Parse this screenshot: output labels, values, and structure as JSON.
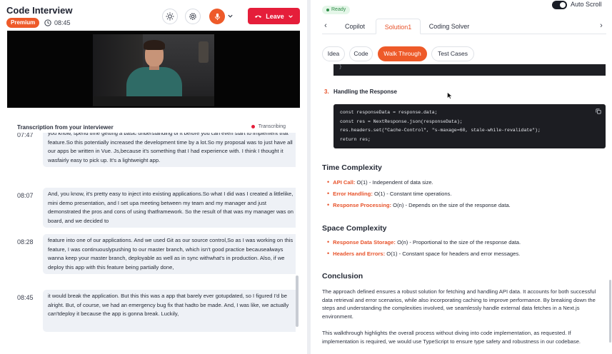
{
  "header": {
    "title": "Code Interview",
    "plan_badge": "Premium",
    "timer": "08:45",
    "leave_label": "Leave",
    "icons": [
      "sun-icon",
      "gear-icon",
      "microphone-icon",
      "chevron-down-icon"
    ]
  },
  "transcript": {
    "title": "Transcription from your interviewer",
    "status": "Transcribing",
    "items": [
      {
        "time": "07:47",
        "text": "you know, spend time getting a basic understanding of it before you can even start to implement that feature.So this potentially increased the development time by a lot.So my proposal was to just have all our apps be written in Vue. Js,because it's something that I had experience with. I think I thought it wasfairly easy to pick up. It's a lightweight app."
      },
      {
        "time": "08:07",
        "text": "And, you know, it's pretty easy to inject into existing applications.So what I did was I created a littlelike, mini demo presentation, and I set upa meeting between my team and my manager and just demonstrated the pros and cons of using thatframework. So the result of that was my manager was on board, and we decided to"
      },
      {
        "time": "08:28",
        "text": "feature into one of our applications. And we used Git as our source control,So as I was working on this feature, I was continuouslypushing to our master branch, which isn't good practice becausealways wanna keep your master branch, deployable as well as in sync withwhat's in production. Also, if we deploy this app with this feature being partially done,"
      },
      {
        "time": "08:45",
        "text": "it would break the application. But this this was a app that barely ever gotupdated, so I figured I'd be alright. But, of course, we had an emergency bug fix that hadto be made. And, I was like, we actually can'tdeploy it because the app is gonna break. Luckily,"
      }
    ]
  },
  "copilot": {
    "status": "Ready",
    "auto_scroll_label": "Auto Scroll",
    "auto_scroll_on": true,
    "tabs": [
      "Copilot",
      "Solution1",
      "Coding Solver"
    ],
    "active_tab": "Solution1",
    "sub_tabs": [
      "Idea",
      "Code",
      "Walk Through",
      "Test Cases"
    ],
    "active_sub_tab": "Walk Through",
    "prev_code_tail": "}",
    "step": {
      "number": "3.",
      "title": "Handling the Response",
      "code": [
        "const responseData = response.data;",
        "const res = NextResponse.json(responseData);",
        "res.headers.set(\"Cache-Control\", \"s-maxage=60, stale-while-revalidate\");",
        "return res;"
      ]
    },
    "time_complexity": {
      "heading": "Time Complexity",
      "items": [
        {
          "key": "API Call:",
          "value": "O(1) - Independent of data size."
        },
        {
          "key": "Error Handling:",
          "value": "O(1) - Constant time operations."
        },
        {
          "key": "Response Processing:",
          "value": "O(n) - Depends on the size of the response data."
        }
      ]
    },
    "space_complexity": {
      "heading": "Space Complexity",
      "items": [
        {
          "key": "Response Data Storage:",
          "value": "O(n) - Proportional to the size of the response data."
        },
        {
          "key": "Headers and Errors:",
          "value": "O(1) - Constant space for headers and error messages."
        }
      ]
    },
    "conclusion": {
      "heading": "Conclusion",
      "p1": "The approach defined ensures a robust solution for fetching and handling API data. It accounts for both successful data retrieval and error scenarios, while also incorporating caching to improve performance. By breaking down the steps and understanding the complexities involved, we seamlessly handle external data fetches in a Next.js environment.",
      "p2": "This walkthrough highlights the overall process without diving into code implementation, as requested. If implementation is required, we would use TypeScript to ensure type safety and robustness in our codebase."
    }
  },
  "colors": {
    "accent": "#ee5a29",
    "leave": "#e51e3a",
    "code_bg": "#1c1d22"
  }
}
